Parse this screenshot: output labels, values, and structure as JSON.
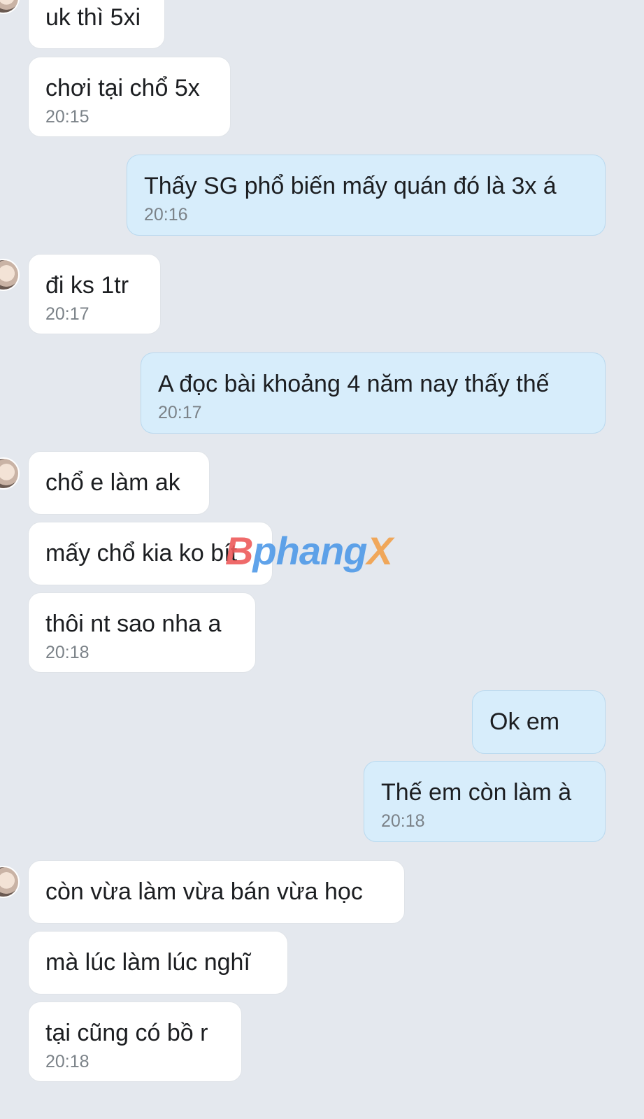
{
  "messages": [
    {
      "side": "in",
      "text": "uk thì 5xi",
      "time": ""
    },
    {
      "side": "in",
      "text": "chơi tại chổ 5x",
      "time": "20:15"
    },
    {
      "side": "out",
      "text": "Thấy SG phổ biến mấy quán đó là 3x á",
      "time": "20:16"
    },
    {
      "side": "in",
      "text": "đi ks 1tr",
      "time": "20:17"
    },
    {
      "side": "out",
      "text": "A đọc bài khoảng 4 năm nay thấy thế",
      "time": "20:17"
    },
    {
      "side": "in",
      "text": "chổ e làm ak",
      "time": ""
    },
    {
      "side": "in",
      "text": "mấy chổ kia ko bít",
      "time": ""
    },
    {
      "side": "in",
      "text": "thôi nt sao nha a",
      "time": "20:18"
    },
    {
      "side": "out",
      "text": "Ok em",
      "time": ""
    },
    {
      "side": "out",
      "text": "Thế em còn làm à",
      "time": "20:18"
    },
    {
      "side": "in",
      "text": "còn vừa làm vừa bán vừa học",
      "time": ""
    },
    {
      "side": "in",
      "text": "mà lúc làm lúc nghĩ",
      "time": ""
    },
    {
      "side": "in",
      "text": "tại cũng có bồ r",
      "time": "20:18"
    }
  ],
  "watermark": {
    "prefix": "B",
    "main": "phang",
    "suffix": "X"
  },
  "colors": {
    "background": "#e4e8ee",
    "incoming_bubble": "#ffffff",
    "outgoing_bubble": "#d7edfb",
    "timestamp": "#7b8288"
  },
  "icons": {
    "avatar": "contact-avatar"
  }
}
